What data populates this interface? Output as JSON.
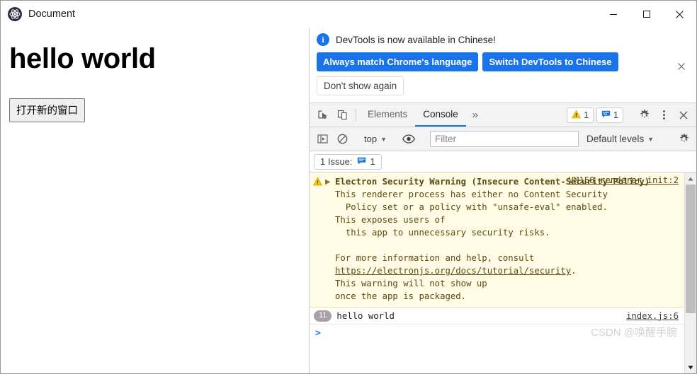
{
  "window": {
    "title": "Document",
    "app_icon": "electron-logo-icon",
    "controls": {
      "minimize": "minimize-icon",
      "maximize": "maximize-icon",
      "close": "close-icon"
    }
  },
  "page": {
    "heading": "hello world",
    "button_label": "打开新的窗口"
  },
  "devtools": {
    "infobar": {
      "icon": "i",
      "message": "DevTools is now available in Chinese!",
      "primary_buttons": [
        "Always match Chrome's language",
        "Switch DevTools to Chinese"
      ],
      "secondary_button": "Don't show again",
      "close": "×"
    },
    "tabbar": {
      "inspect_icon": "inspect-cursor-icon",
      "device_icon": "device-toolbar-icon",
      "tabs": [
        {
          "label": "Elements",
          "active": false
        },
        {
          "label": "Console",
          "active": true
        }
      ],
      "more_tabs": "»",
      "warning_count": "1",
      "message_count": "1",
      "settings_icon": "gear-icon",
      "menu_icon": "kebab-menu-icon",
      "close_icon": "close-icon"
    },
    "console_toolbar": {
      "sidebar_icon": "console-sidebar-icon",
      "clear_icon": "clear-console-icon",
      "context": "top",
      "eye_icon": "live-expression-eye-icon",
      "filter_placeholder": "Filter",
      "filter_value": "",
      "levels": "Default levels",
      "settings_icon": "gear-icon"
    },
    "issues_bar": {
      "label": "1 Issue:",
      "count": "1"
    },
    "console": {
      "warning": {
        "source": "VM158 renderer_init:2",
        "title": "Electron Security Warning (Insecure Content-Security-Policy)",
        "line1": "This renderer process has either no Content Security",
        "line2": "  Policy set or a policy with \"unsafe-eval\" enabled.",
        "line3": "This exposes users of",
        "line4": "  this app to unnecessary security risks.",
        "line5": "For more information and help, consult",
        "link": "https://electronjs.org/docs/tutorial/security",
        "link_suffix": ".",
        "line6": "This warning will not show up",
        "line7": "once the app is packaged."
      },
      "log": {
        "count": "11",
        "text": "hello world",
        "source": "index.js:6"
      },
      "prompt": ">"
    },
    "watermark": "CSDN @唤醒手腕"
  },
  "colors": {
    "accent": "#1a73e8",
    "warning_bg": "#fffbe5",
    "warning_text": "#5c4b13",
    "badge": "#a8a0a8"
  }
}
